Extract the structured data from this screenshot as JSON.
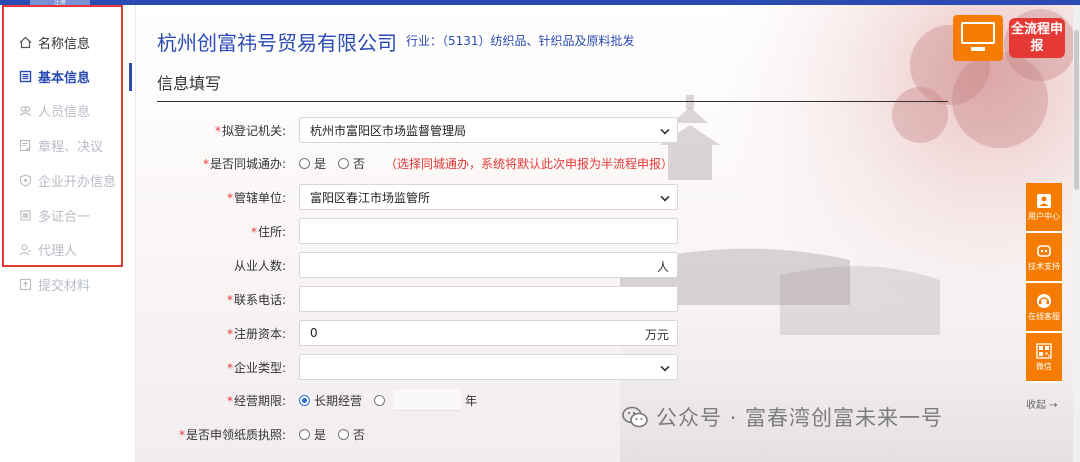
{
  "topbar": {
    "tab_label": "注册"
  },
  "sidebar": {
    "items": [
      {
        "label": "名称信息",
        "icon": "home-icon",
        "state": "done"
      },
      {
        "label": "基本信息",
        "icon": "document-icon",
        "state": "active"
      },
      {
        "label": "人员信息",
        "icon": "people-icon",
        "state": "pending"
      },
      {
        "label": "章程、决议",
        "icon": "doc-check-icon",
        "state": "pending"
      },
      {
        "label": "企业开办信息",
        "icon": "shield-icon",
        "state": "pending"
      },
      {
        "label": "多证合一",
        "icon": "stack-icon",
        "state": "pending"
      },
      {
        "label": "代理人",
        "icon": "person-icon",
        "state": "pending"
      },
      {
        "label": "提交材料",
        "icon": "upload-icon",
        "state": "pending"
      }
    ]
  },
  "header": {
    "company_name": "杭州创富祎号贸易有限公司",
    "industry": "行业：（5131）纺织品、针织品及原料批发",
    "badge_label": "全流程申报"
  },
  "form": {
    "section_title": "信息填写",
    "registration_authority": {
      "label": "拟登记机关:",
      "value": "杭州市富阳区市场监督管理局"
    },
    "same_city": {
      "label": "是否同城通办:",
      "opt_yes": "是",
      "opt_no": "否",
      "note": "（选择同城通办，系统将默认此次申报为半流程申报）"
    },
    "jurisdiction": {
      "label": "管辖单位:",
      "value": "富阳区春江市场监管所"
    },
    "address": {
      "label": "住所:",
      "value": ""
    },
    "employees": {
      "label": "从业人数:",
      "value": "",
      "unit": "人"
    },
    "phone": {
      "label": "联系电话:",
      "value": ""
    },
    "capital": {
      "label": "注册资本:",
      "value": "0",
      "unit": "万元"
    },
    "company_type": {
      "label": "企业类型:",
      "value": ""
    },
    "term": {
      "label": "经营期限:",
      "opt_long": "长期经营",
      "unit": "年"
    },
    "paper_license": {
      "label": "是否申领纸质执照:",
      "opt_yes": "是",
      "opt_no": "否"
    }
  },
  "dock": {
    "items": [
      {
        "label": "用户中心",
        "icon": "user-icon"
      },
      {
        "label": "技术支持",
        "icon": "robot-icon"
      },
      {
        "label": "在线客服",
        "icon": "headset-icon"
      },
      {
        "label": "微信",
        "icon": "qrcode-icon"
      }
    ],
    "collapse_label": "收起 →"
  },
  "watermark": {
    "text": "公众号 · 富春湾创富未来一号"
  },
  "colors": {
    "primary": "#2b4bb3",
    "accent": "#f57c00",
    "alert": "#e53935"
  }
}
